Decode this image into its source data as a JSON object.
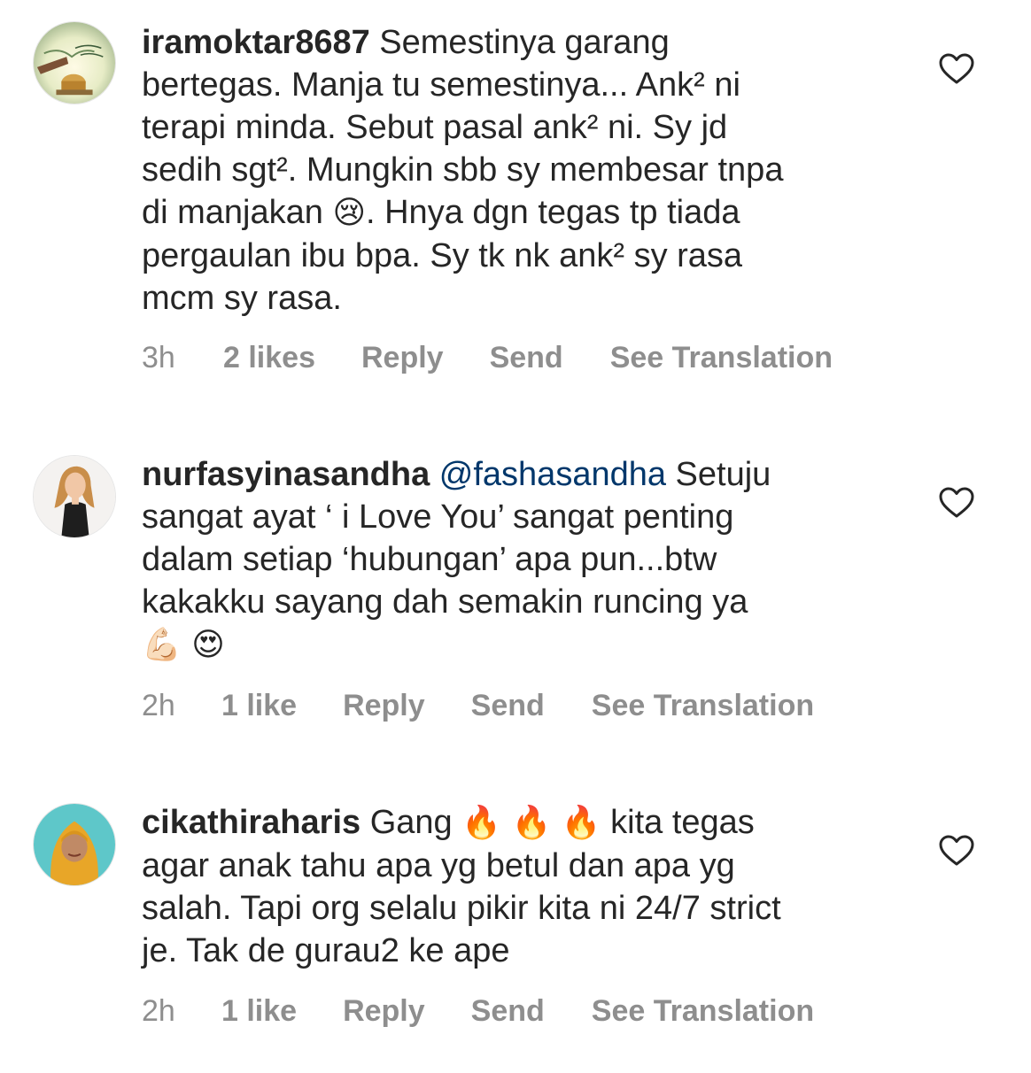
{
  "comments": [
    {
      "username": "iramoktar8687",
      "mention": "",
      "text_lines": [
        "Semestinya garang",
        "bertegas. Manja tu semestinya... Ank² ni",
        "terapi minda. Sebut pasal ank² ni. Sy jd",
        "sedih sgt². Mungkin sbb sy membesar tnpa",
        "di manjakan ",
        ". Hnya dgn tegas tp tiada",
        "pergaulan ibu bpa. Sy tk nk ank² sy rasa",
        "mcm sy rasa."
      ],
      "emoji": "😢",
      "time": "3h",
      "likes": "2 likes",
      "reply_label": "Reply",
      "send_label": "Send",
      "translation_label": "See Translation",
      "like_icon": "heart-outline-icon"
    },
    {
      "username": "nurfasyinasandha",
      "mention": "@fashasandha",
      "text_lines": [
        " Setuju",
        "sangat ayat ‘ i Love You’ sangat penting",
        "dalam setiap ‘hubungan’ apa pun...btw",
        "kakakku sayang dah semakin runcing ya"
      ],
      "emoji": "💪🏻 😍",
      "time": "2h",
      "likes": "1 like",
      "reply_label": "Reply",
      "send_label": "Send",
      "translation_label": "See Translation",
      "like_icon": "heart-outline-icon"
    },
    {
      "username": "cikathiraharis",
      "mention": "",
      "text_lines": [
        "Gang ",
        " kita tegas",
        "agar anak tahu apa yg betul dan apa yg",
        "salah. Tapi org selalu pikir kita ni 24/7 strict",
        "je. Tak de gurau2 ke ape"
      ],
      "emoji": "🔥 🔥 🔥",
      "time": "2h",
      "likes": "1 like",
      "reply_label": "Reply",
      "send_label": "Send",
      "translation_label": "See Translation",
      "like_icon": "heart-outline-icon"
    }
  ],
  "colors": {
    "text": "#262626",
    "secondary": "#8e8e8e",
    "mention": "#00376b",
    "background": "#ffffff"
  }
}
